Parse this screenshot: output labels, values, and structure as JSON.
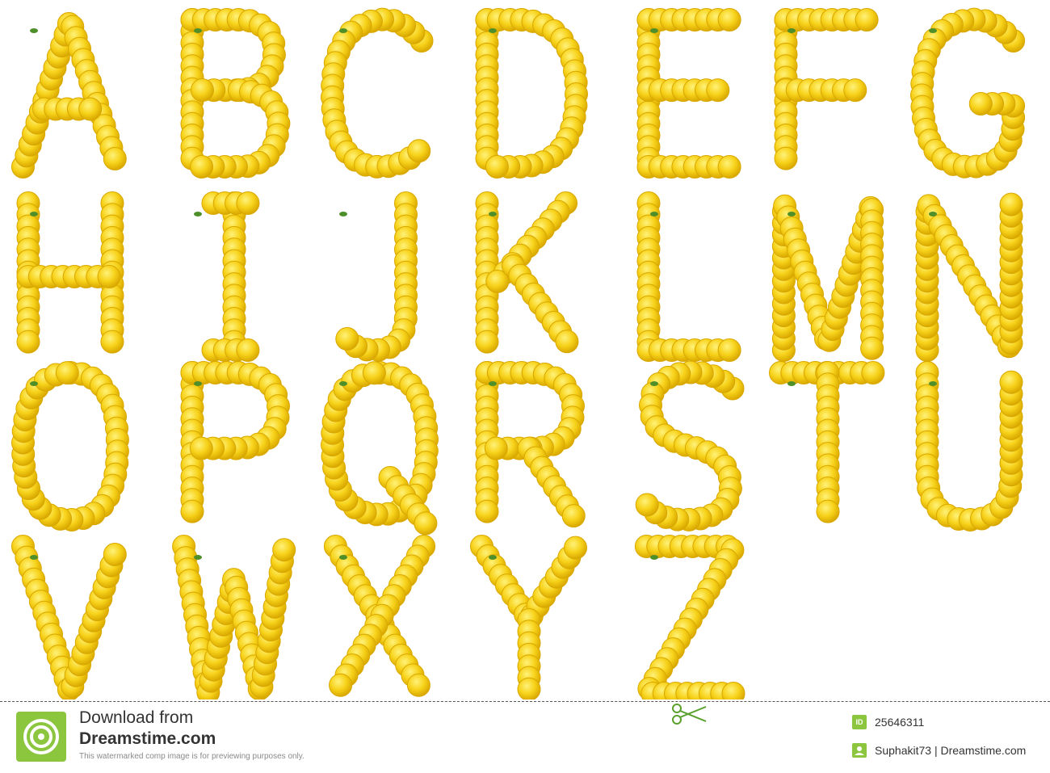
{
  "letters": [
    "A",
    "B",
    "C",
    "D",
    "E",
    "F",
    "G",
    "H",
    "I",
    "J",
    "K",
    "L",
    "M",
    "N",
    "O",
    "P",
    "Q",
    "R",
    "S",
    "T",
    "U",
    "V",
    "W",
    "X",
    "Y",
    "Z"
  ],
  "colors": {
    "flower": "#f7d21a",
    "flower_shade": "#d9a800",
    "leaf": "#4f8f2a",
    "brand_green": "#8cc63f",
    "text": "#333333"
  },
  "footer": {
    "download_label": "Download from",
    "brand": "Dreamstime.com",
    "note": "This watermarked comp image is for previewing purposes only.",
    "id_badge": "ID",
    "id_value": "25646311",
    "credit": "Suphakit73 | Dreamstime.com",
    "logo_icon": "dreamstime-spiral-icon",
    "scissors_icon": "scissors-icon",
    "user_icon": "user-icon"
  }
}
